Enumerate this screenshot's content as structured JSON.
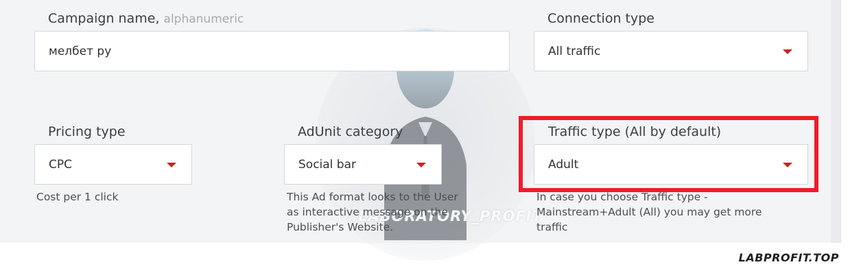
{
  "campaign": {
    "label": "Campaign name",
    "hint": "alphanumeric",
    "value": "мелбет ру"
  },
  "connection": {
    "label": "Connection type",
    "value": "All traffic"
  },
  "pricing": {
    "label": "Pricing type",
    "value": "CPC",
    "help": [
      "Cost per 1 click"
    ]
  },
  "adunit": {
    "label": "AdUnit category",
    "value": "Social bar",
    "help": [
      "This Ad format looks to the User",
      "as interactive message on the",
      "Publisher's Website."
    ]
  },
  "traffic": {
    "label": "Traffic type (All by default)",
    "value": "Adult",
    "help": [
      "In case you choose Traffic type -",
      "Mainstream+Adult (All) you may get more",
      "traffic"
    ]
  },
  "watermark": {
    "text": "LABORATORY_PROFIT"
  },
  "brand": {
    "text": "LABPROFIT.TOP"
  },
  "colors": {
    "accent_caret": "#d0201f",
    "highlight_border": "#ee1c2a"
  },
  "icons": {
    "dropdown": "caret-down-icon"
  }
}
